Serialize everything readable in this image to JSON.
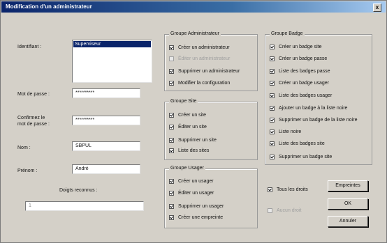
{
  "window": {
    "title": "Modification d'un administrateur",
    "close_label": "x"
  },
  "form": {
    "identifiant_label": "Identifiant :",
    "identifiant_selected": "Superviseur",
    "password_label": "Mot de passe :",
    "password_value": "**********",
    "confirm_label_1": "Confirmez le",
    "confirm_label_2": "mot de passe :",
    "confirm_value": "**********",
    "nom_label": "Nom :",
    "nom_value": "SBPUL",
    "prenom_label": "Prénom :",
    "prenom_value": "André",
    "doigts_label": "Doigts reconnus :",
    "doigts_value": "1"
  },
  "groups": {
    "admin": {
      "title": "Groupe Administrateur",
      "items": [
        {
          "label": "Créer un administrateur",
          "checked": true,
          "disabled": false
        },
        {
          "label": "Éditer un administrateur",
          "checked": false,
          "disabled": true
        },
        {
          "label": "Supprimer un administrateur",
          "checked": true,
          "disabled": false
        },
        {
          "label": "Modifier la configuration",
          "checked": true,
          "disabled": false
        }
      ]
    },
    "site": {
      "title": "Groupe Site",
      "items": [
        {
          "label": "Créer un site",
          "checked": true,
          "disabled": false
        },
        {
          "label": "Éditer un site",
          "checked": true,
          "disabled": false
        },
        {
          "label": "Supprimer un site",
          "checked": true,
          "disabled": false
        },
        {
          "label": "Liste des sites",
          "checked": true,
          "disabled": false
        }
      ]
    },
    "usager": {
      "title": "Groupe Usager",
      "items": [
        {
          "label": "Créer un usager",
          "checked": true,
          "disabled": false
        },
        {
          "label": "Éditer un usager",
          "checked": true,
          "disabled": false
        },
        {
          "label": "Supprimer un usager",
          "checked": true,
          "disabled": false
        },
        {
          "label": "Créer une empreinte",
          "checked": true,
          "disabled": false
        }
      ]
    },
    "badge": {
      "title": "Groupe Badge",
      "items": [
        {
          "label": "Créer un badge site",
          "checked": true,
          "disabled": false
        },
        {
          "label": "Créer un badge passe",
          "checked": true,
          "disabled": false
        },
        {
          "label": "Liste des badges passe",
          "checked": true,
          "disabled": false
        },
        {
          "label": "Créer un badge usager",
          "checked": true,
          "disabled": false
        },
        {
          "label": "Liste des badges usager",
          "checked": true,
          "disabled": false
        },
        {
          "label": "Ajouter un badge à la liste noire",
          "checked": true,
          "disabled": false
        },
        {
          "label": "Supprimer un badge de la liste noire",
          "checked": true,
          "disabled": false
        },
        {
          "label": "Liste noire",
          "checked": true,
          "disabled": false
        },
        {
          "label": "Liste des badges site",
          "checked": true,
          "disabled": false
        },
        {
          "label": "Supprimer un badge site",
          "checked": true,
          "disabled": false
        }
      ]
    }
  },
  "options": {
    "all_rights": {
      "label": "Tous les droits",
      "checked": true,
      "disabled": false
    },
    "second": {
      "label": "Aucun droit",
      "checked": false,
      "disabled": true
    }
  },
  "buttons": {
    "empreintes": "Empreintes",
    "ok": "OK",
    "annuler": "Annuler"
  }
}
